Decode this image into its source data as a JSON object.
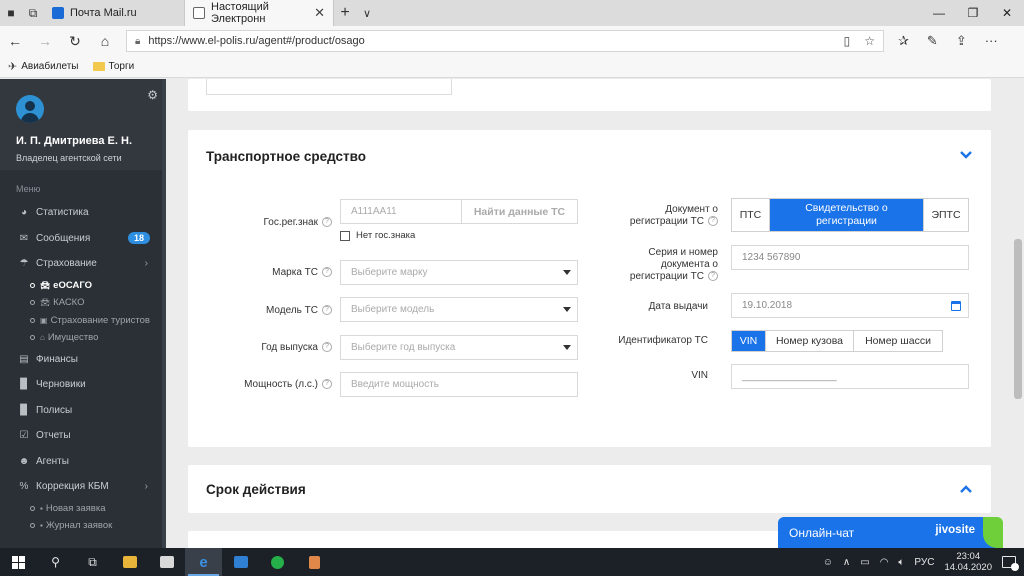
{
  "browser": {
    "tabs": [
      {
        "title": "Почта Mail.ru"
      },
      {
        "title": "Настоящий Электронн"
      }
    ],
    "url": "https://www.el-polis.ru/agent#/product/osago",
    "bookmarks": [
      {
        "label": "Авиабилеты",
        "icon": "plane-icon"
      },
      {
        "label": "Торги",
        "icon": "folder-icon"
      }
    ]
  },
  "sidebar": {
    "user_name": "И. П. Дмитриева Е. Н.",
    "user_role": "Владелец агентской сети",
    "menu_header": "Меню",
    "items": [
      {
        "label": "Статистика",
        "icon": "pie-chart-icon"
      },
      {
        "label": "Сообщения",
        "icon": "envelope-icon",
        "badge": "18"
      },
      {
        "label": "Страхование",
        "icon": "umbrella-icon",
        "has_children": true
      },
      {
        "label": "Финансы",
        "icon": "money-icon"
      },
      {
        "label": "Черновики",
        "icon": "document-icon"
      },
      {
        "label": "Полисы",
        "icon": "file-icon"
      },
      {
        "label": "Отчеты",
        "icon": "clipboard-icon"
      },
      {
        "label": "Агенты",
        "icon": "users-icon"
      },
      {
        "label": "Коррекция КБМ",
        "icon": "percent-icon",
        "has_children": true
      }
    ],
    "insurance_sub": [
      {
        "label": "еОСАГО",
        "active": true
      },
      {
        "label": "КАСКО"
      },
      {
        "label": "Страхование туристов"
      },
      {
        "label": "Имущество"
      }
    ],
    "kbm_sub": [
      {
        "label": "Новая заявка"
      },
      {
        "label": "Журнал заявок"
      }
    ]
  },
  "vehicle": {
    "title": "Транспортное средство",
    "reg_label": "Гос.рег.знак",
    "reg_placeholder": "А111АА11",
    "find_btn": "Найти данные ТС",
    "no_plate": "Нет гос.знака",
    "brand_label": "Марка ТС",
    "brand_placeholder": "Выберите марку",
    "model_label": "Модель ТС",
    "model_placeholder": "Выберите модель",
    "year_label": "Год выпуска",
    "year_placeholder": "Выберите год выпуска",
    "power_label": "Мощность (л.с.)",
    "power_placeholder": "Введите мощность",
    "doc_label_1": "Документ о",
    "doc_label_2": "регистрации ТС",
    "doc_options": [
      "ПТС",
      "Свидетельство о регистрации",
      "ЭПТС"
    ],
    "doc_selected": "Свидетельство о регистрации",
    "series_label_1": "Серия и номер",
    "series_label_2": "документа о",
    "series_label_3": "регистрации ТС",
    "series_placeholder": "1234 567890",
    "issue_label": "Дата выдачи",
    "issue_placeholder": "19.10.2018",
    "id_label": "Идентификатор ТС",
    "id_options": [
      "VIN",
      "Номер кузова",
      "Номер шасси"
    ],
    "id_selected": "VIN",
    "vin_label": "VIN",
    "vin_placeholder": "_________________"
  },
  "period": {
    "title": "Срок действия"
  },
  "chat": {
    "label": "Онлайн-чат",
    "brand": "jivosite"
  },
  "taskbar": {
    "lang": "РУС",
    "time": "23:04",
    "date": "14.04.2020"
  },
  "colors": {
    "accent": "#1a73e8",
    "sidebar_bg": "#2b3036",
    "chat_indicator": "#6fcf3b"
  }
}
